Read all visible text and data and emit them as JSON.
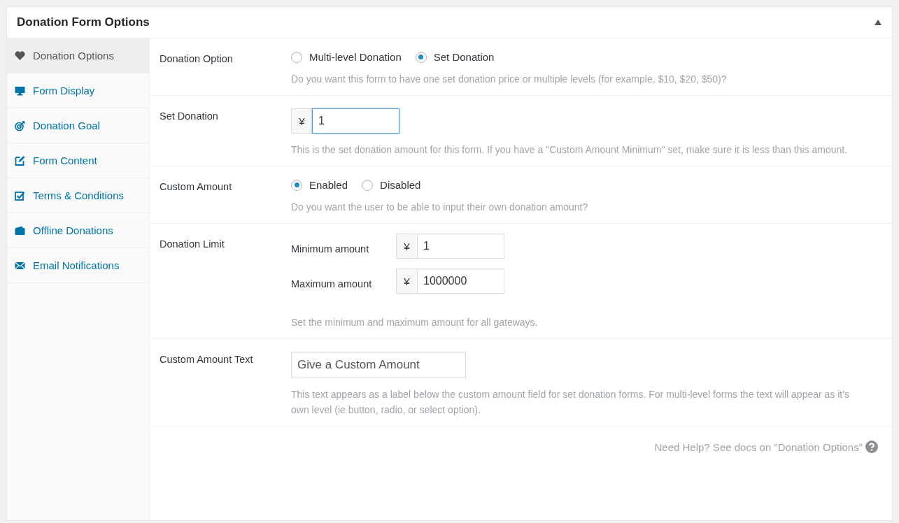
{
  "panel": {
    "title": "Donation Form Options",
    "expanded": true
  },
  "tabs": [
    {
      "label": "Donation Options",
      "kind": "heart",
      "selected": true
    },
    {
      "label": "Form Display",
      "kind": "monitor",
      "selected": false
    },
    {
      "label": "Donation Goal",
      "kind": "target",
      "selected": false
    },
    {
      "label": "Form Content",
      "kind": "edit",
      "selected": false
    },
    {
      "label": "Terms & Conditions",
      "kind": "checkbox",
      "selected": false
    },
    {
      "label": "Offline Donations",
      "kind": "wallet",
      "selected": false
    },
    {
      "label": "Email Notifications",
      "kind": "envelope",
      "selected": false
    }
  ],
  "rows": [
    {
      "kind": "radio",
      "label": "Donation Option",
      "options": [
        {
          "label": "Multi-level Donation",
          "selected": false
        },
        {
          "label": "Set Donation",
          "selected": true
        }
      ],
      "description": "Do you want this form to have one set donation price or multiple levels (for example, $10, $20, $50)?"
    },
    {
      "kind": "currency",
      "label": "Set Donation",
      "symbol": "¥",
      "value": "1",
      "focused": true,
      "description": "This is the set donation amount for this form. If you have a \"Custom Amount Minimum\" set, make sure it is less than this amount."
    },
    {
      "kind": "radio",
      "label": "Custom Amount",
      "options": [
        {
          "label": "Enabled",
          "selected": true
        },
        {
          "label": "Disabled",
          "selected": false
        }
      ],
      "description": "Do you want the user to be able to input their own donation amount?"
    },
    {
      "kind": "range",
      "label": "Donation Limit",
      "fields": [
        {
          "label": "Minimum amount",
          "symbol": "¥",
          "value": "1"
        },
        {
          "label": "Maximum amount",
          "symbol": "¥",
          "value": "1000000"
        }
      ],
      "description": "Set the minimum and maximum amount for all gateways."
    },
    {
      "kind": "text",
      "label": "Custom Amount Text",
      "value": "Give a Custom Amount",
      "description": "This text appears as a label below the custom amount field for set donation forms. For multi-level forms the text will appear as it's own level (ie button, radio, or select option)."
    }
  ],
  "help": {
    "text": "Need Help? See docs on \"Donation Options\""
  }
}
